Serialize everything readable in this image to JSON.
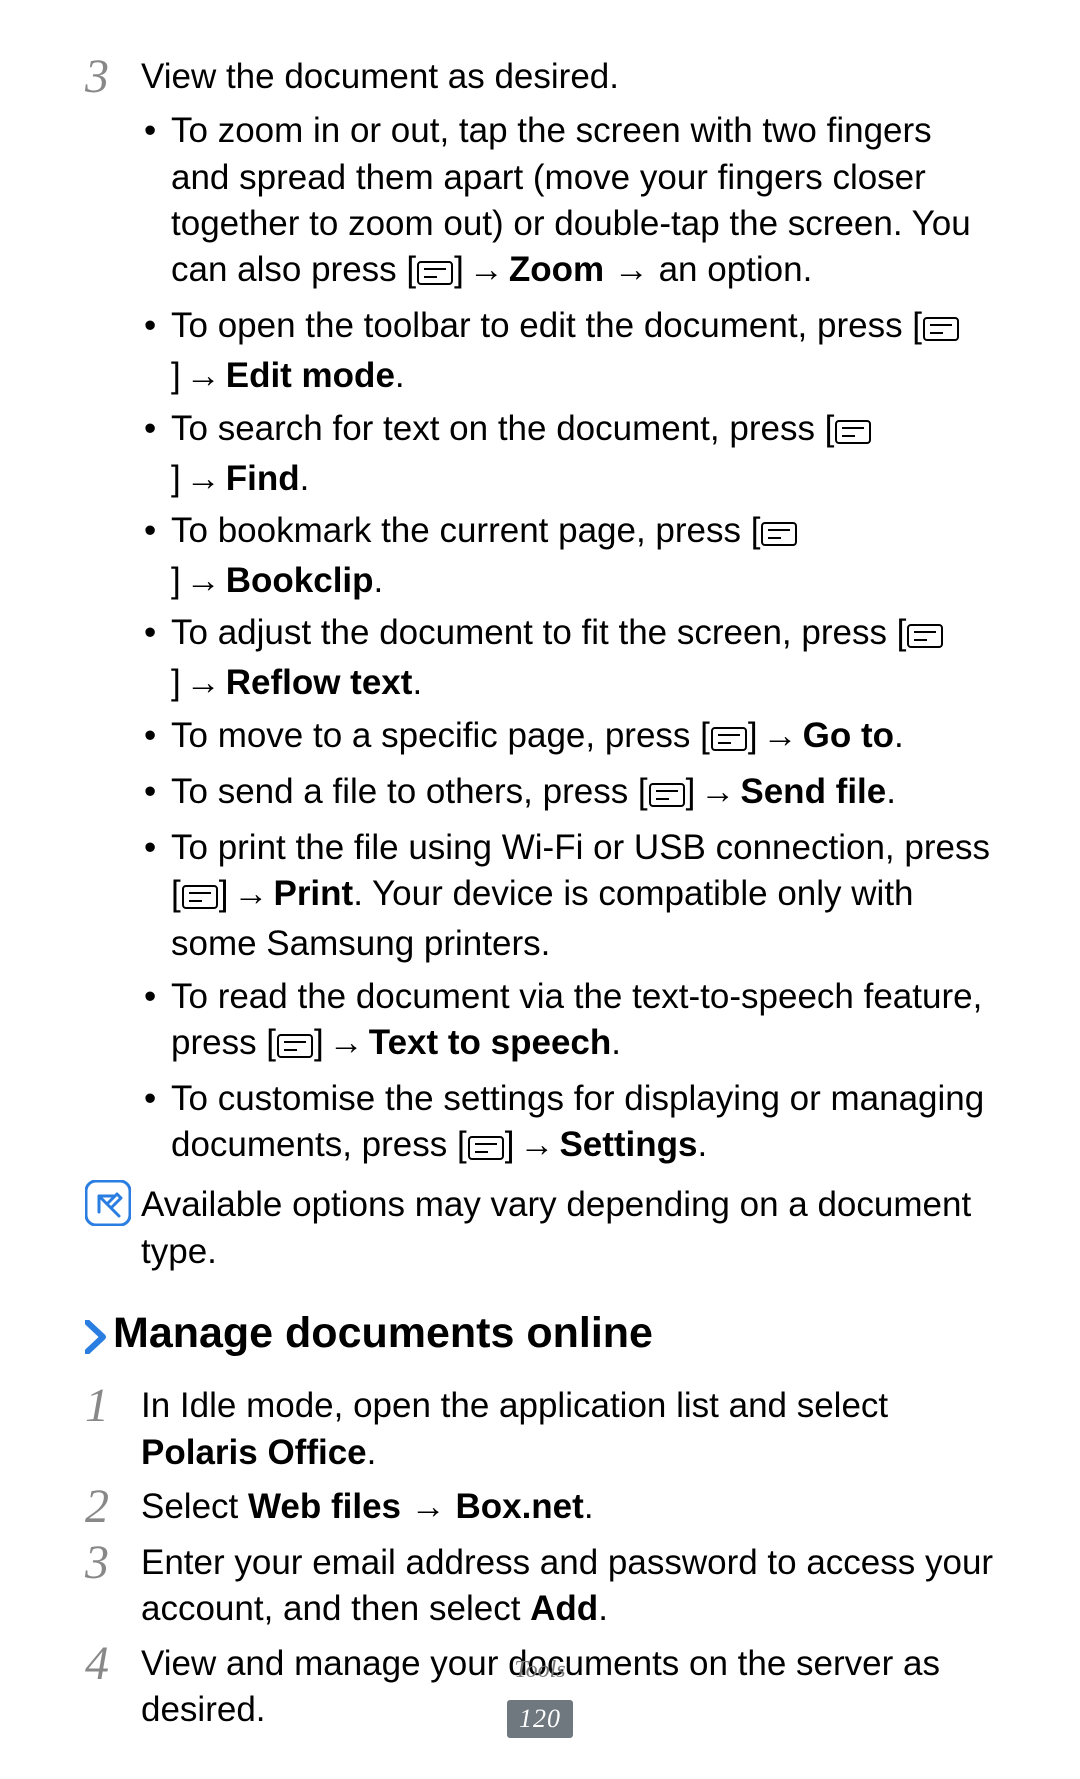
{
  "step3": {
    "num": "3",
    "heading": "View the document as desired.",
    "bullets": [
      {
        "pre": "To zoom in or out, tap the screen with two fingers and spread them apart (move your fingers closer together to zoom out) or double-tap the screen. You can also press [",
        "bold1": "Zoom",
        "mid": " → an option.",
        "type": "zoom"
      },
      {
        "pre": "To open the toolbar to edit the document, press [",
        "bold1": "Edit mode",
        "post": ".",
        "type": "simple"
      },
      {
        "pre": "To search for text on the document, press [",
        "bold1": "Find",
        "post": ".",
        "type": "simple"
      },
      {
        "pre": "To bookmark the current page, press [",
        "bold1": "Bookclip",
        "post": ".",
        "type": "simple"
      },
      {
        "pre": "To adjust the document to fit the screen, press [",
        "bold1": "Reflow text",
        "post": ".",
        "type": "simple"
      },
      {
        "pre": "To move to a specific page, press [",
        "bold1": "Go to",
        "post": ".",
        "type": "simple"
      },
      {
        "pre": "To send a file to others, press [",
        "bold1": "Send file",
        "post": ".",
        "type": "simple"
      },
      {
        "pre": "To print the file using Wi-Fi or USB connection, press [",
        "bold1": "Print",
        "mid": ". Your device is compatible only with some Samsung printers.",
        "type": "print"
      },
      {
        "pre": "To read the document via the text-to-speech feature, press [",
        "bold1": "Text to speech",
        "post": ".",
        "type": "simple"
      },
      {
        "pre": "To customise the settings for displaying or managing documents, press [",
        "bold1": "Settings",
        "post": ".",
        "type": "simple"
      }
    ]
  },
  "note": "Available options may vary depending on a document type.",
  "section_heading": "Manage documents online",
  "steps_online": {
    "s1": {
      "num": "1",
      "pre": "In Idle mode, open the application list and select ",
      "bold": "Polaris Office",
      "post": "."
    },
    "s2": {
      "num": "2",
      "pre": "Select ",
      "bold": "Web files → Box.net",
      "post": "."
    },
    "s3": {
      "num": "3",
      "pre": "Enter your email address and password to access your account, and then select ",
      "bold": "Add",
      "post": "."
    },
    "s4": {
      "num": "4",
      "text": "View and manage your documents on the server as desired."
    }
  },
  "footer": {
    "category": "Tools",
    "page": "120"
  }
}
